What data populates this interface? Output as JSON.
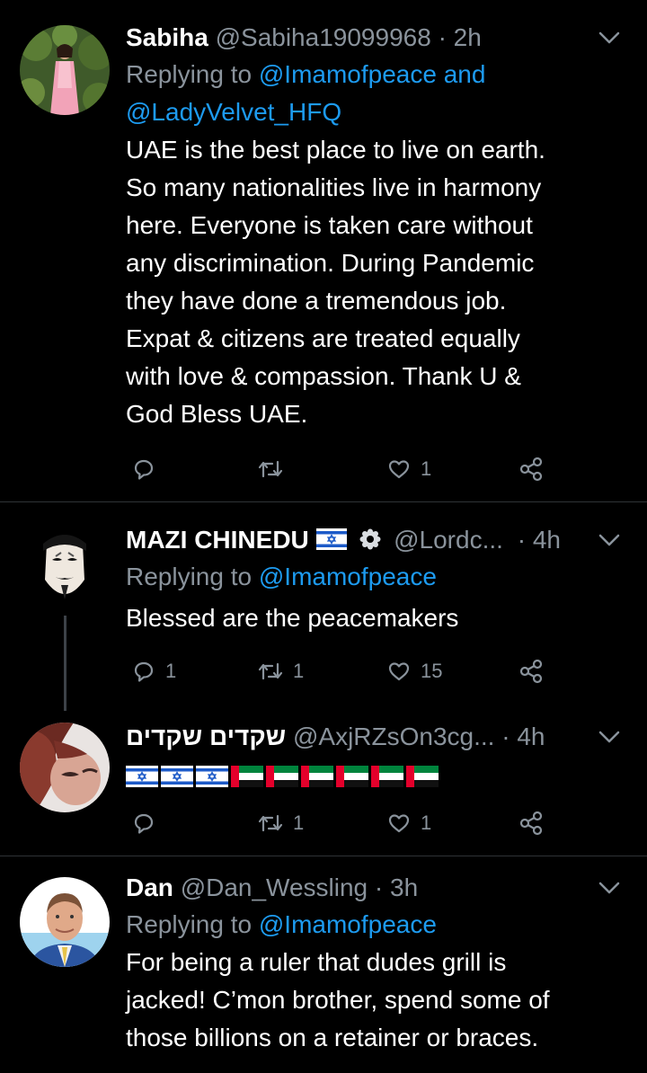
{
  "tweets": [
    {
      "name": "Sabiha",
      "handle": "@Sabiha19099968",
      "sep": "·",
      "time": "2h",
      "replying_prefix": "Replying to ",
      "replying_links": "@Imamofpeace and @LadyVelvet_HFQ",
      "text_lines": [
        "UAE is the best place to live on earth.",
        "So many nationalities live in harmony",
        "here. Everyone is taken care without",
        "any discrimination. During Pandemic",
        "they have done a tremendous job.",
        "Expat & citizens are treated equally",
        "with love & compassion. Thank U &",
        "God Bless UAE."
      ],
      "reply_count": "",
      "retweet_count": "",
      "like_count": "1"
    },
    {
      "name": "MAZI CHINEDU",
      "handle": "@Lordc...",
      "sep": "·",
      "time": "4h",
      "replying_prefix": "Replying to ",
      "replying_links": "@Imamofpeace",
      "text_lines": [
        "Blessed are the peacemakers"
      ],
      "reply_count": "1",
      "retweet_count": "1",
      "like_count": "15"
    },
    {
      "name": "שקדים שקדים",
      "handle": "@AxjRZsOn3cg...",
      "sep": "·",
      "time": "4h",
      "reply_count": "",
      "retweet_count": "1",
      "like_count": "1"
    },
    {
      "name": "Dan",
      "handle": "@Dan_Wessling",
      "sep": "·",
      "time": "3h",
      "replying_prefix": "Replying to ",
      "replying_links": "@Imamofpeace",
      "text_lines": [
        "For being a ruler that dudes grill is",
        "jacked! C’mon brother, spend some of",
        "those billions on a retainer or braces."
      ]
    }
  ],
  "icons": {
    "reply": "reply-icon",
    "retweet": "retweet-icon",
    "like": "like-icon",
    "share": "share-icon",
    "chevron": "chevron-down-icon",
    "verified": "verified-icon",
    "flag_israel": "israel-flag-icon",
    "flag_uae": "uae-flag-icon"
  },
  "colors": {
    "background": "#000000",
    "text": "#ffffff",
    "muted": "#8a939c",
    "link": "#1d9bf0",
    "divider": "#2f3336"
  }
}
